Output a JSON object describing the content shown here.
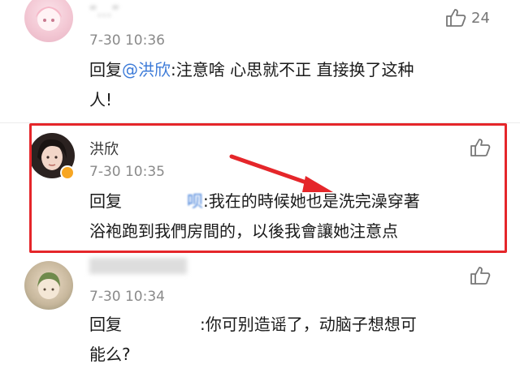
{
  "comments": [
    {
      "name": "“…”",
      "time": "7-30 10:36",
      "likes": "24",
      "reply_prefix": "回复",
      "mention": "@洪欣",
      "text": ":注意啥 心思就不正 直接换了这种",
      "text2": "人!"
    },
    {
      "name": "洪欣",
      "time": "7-30 10:35",
      "reply_prefix": "回复",
      "mention_tail": "呗",
      "text": ":我在的時候她也是洗完澡穿著",
      "text2": "浴袍跑到我們房間的，以後我會讓她注意点"
    },
    {
      "time": "7-30 10:34",
      "reply_prefix": "回复",
      "text": ":你可别造谣了，动脑子想想可",
      "text2": "能么?"
    }
  ],
  "colors": {
    "highlight": "#e5262a",
    "mention": "#3d7bd8"
  }
}
